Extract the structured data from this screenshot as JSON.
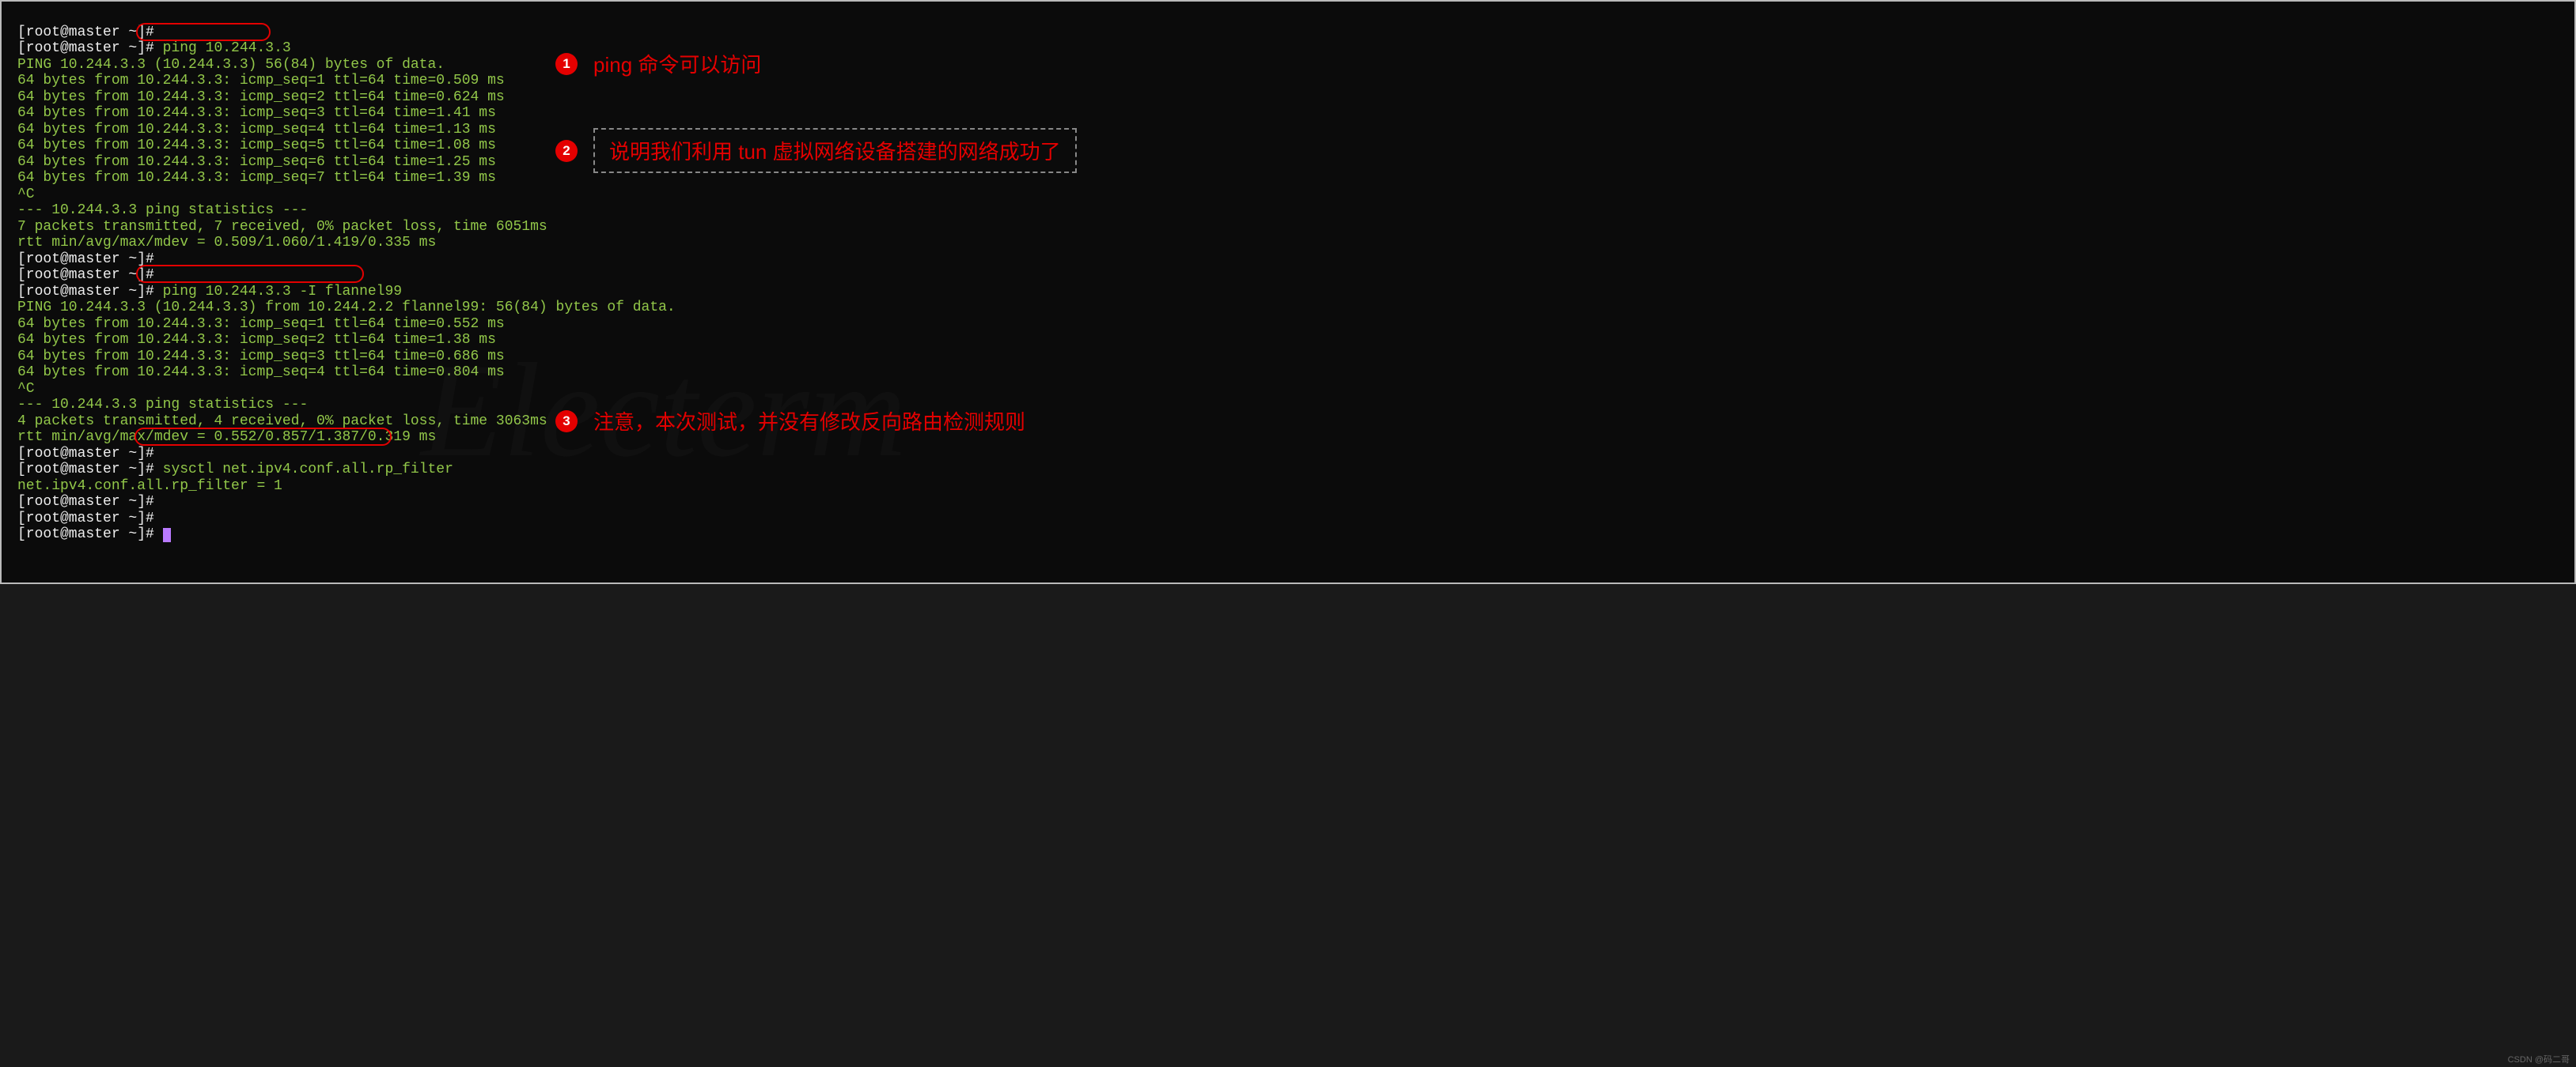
{
  "prompt_prefix": "[root@master ~]#",
  "commands": {
    "ping1": "ping 10.244.3.3",
    "ping2": "ping 10.244.3.3 -I flannel99",
    "sysctl": "sysctl net.ipv4.conf.all.rp_filter"
  },
  "output": {
    "ping1_header": "PING 10.244.3.3 (10.244.3.3) 56(84) bytes of data.",
    "ping1_lines": [
      "64 bytes from 10.244.3.3: icmp_seq=1 ttl=64 time=0.509 ms",
      "64 bytes from 10.244.3.3: icmp_seq=2 ttl=64 time=0.624 ms",
      "64 bytes from 10.244.3.3: icmp_seq=3 ttl=64 time=1.41 ms",
      "64 bytes from 10.244.3.3: icmp_seq=4 ttl=64 time=1.13 ms",
      "64 bytes from 10.244.3.3: icmp_seq=5 ttl=64 time=1.08 ms",
      "64 bytes from 10.244.3.3: icmp_seq=6 ttl=64 time=1.25 ms",
      "64 bytes from 10.244.3.3: icmp_seq=7 ttl=64 time=1.39 ms"
    ],
    "ctrl_c": "^C",
    "ping1_stats_sep": "--- 10.244.3.3 ping statistics ---",
    "ping1_stats_1": "7 packets transmitted, 7 received, 0% packet loss, time 6051ms",
    "ping1_stats_2": "rtt min/avg/max/mdev = 0.509/1.060/1.419/0.335 ms",
    "ping2_header": "PING 10.244.3.3 (10.244.3.3) from 10.244.2.2 flannel99: 56(84) bytes of data.",
    "ping2_lines": [
      "64 bytes from 10.244.3.3: icmp_seq=1 ttl=64 time=0.552 ms",
      "64 bytes from 10.244.3.3: icmp_seq=2 ttl=64 time=1.38 ms",
      "64 bytes from 10.244.3.3: icmp_seq=3 ttl=64 time=0.686 ms",
      "64 bytes from 10.244.3.3: icmp_seq=4 ttl=64 time=0.804 ms"
    ],
    "ping2_stats_1": "4 packets transmitted, 4 received, 0% packet loss, time 3063ms",
    "ping2_stats_2": "rtt min/avg/max/mdev = 0.552/0.857/1.387/0.319 ms",
    "sysctl_out": "net.ipv4.conf.all.rp_filter = 1"
  },
  "annotations": {
    "n1": "1",
    "n2": "2",
    "n3": "3",
    "t1": "ping 命令可以访问",
    "t2": "说明我们利用 tun 虚拟网络设备搭建的网络成功了",
    "t3": "注意，本次测试，并没有修改反向路由检测规则"
  },
  "watermark": "Electerm",
  "credit": "CSDN @码二哥"
}
